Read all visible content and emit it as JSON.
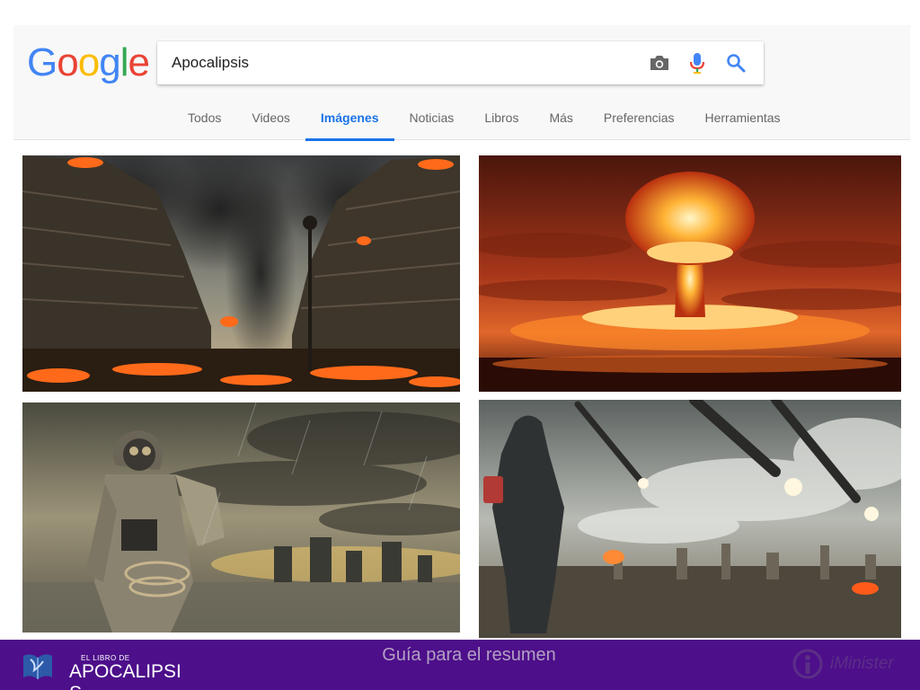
{
  "logo": {
    "letters": [
      {
        "ch": "G",
        "color": "#4285F4"
      },
      {
        "ch": "o",
        "color": "#EA4335"
      },
      {
        "ch": "o",
        "color": "#FBBC05"
      },
      {
        "ch": "g",
        "color": "#4285F4"
      },
      {
        "ch": "l",
        "color": "#34A853"
      },
      {
        "ch": "e",
        "color": "#EA4335"
      }
    ]
  },
  "search": {
    "query": "Apocalipsis",
    "icons": [
      "camera-icon",
      "microphone-icon",
      "search-icon"
    ]
  },
  "tabs": [
    {
      "label": "Todos",
      "active": false
    },
    {
      "label": "Videos",
      "active": false
    },
    {
      "label": "Imágenes",
      "active": true
    },
    {
      "label": "Noticias",
      "active": false
    },
    {
      "label": "Libros",
      "active": false
    },
    {
      "label": "Más",
      "active": false
    },
    {
      "label": "Preferencias",
      "active": false
    },
    {
      "label": "Herramientas",
      "active": false
    }
  ],
  "images": [
    {
      "subject": "burning-city-street"
    },
    {
      "subject": "nuclear-mushroom-cloud"
    },
    {
      "subject": "gas-mask-survivor"
    },
    {
      "subject": "meteors-over-city"
    }
  ],
  "footer": {
    "brand_small": "EL LIBRO DE",
    "brand_line1": "APOCALIPSI",
    "brand_line2": "S",
    "center_text": "Guía para el resumen",
    "right_brand": "iMinister",
    "bar_color": "#4d0f8a"
  }
}
